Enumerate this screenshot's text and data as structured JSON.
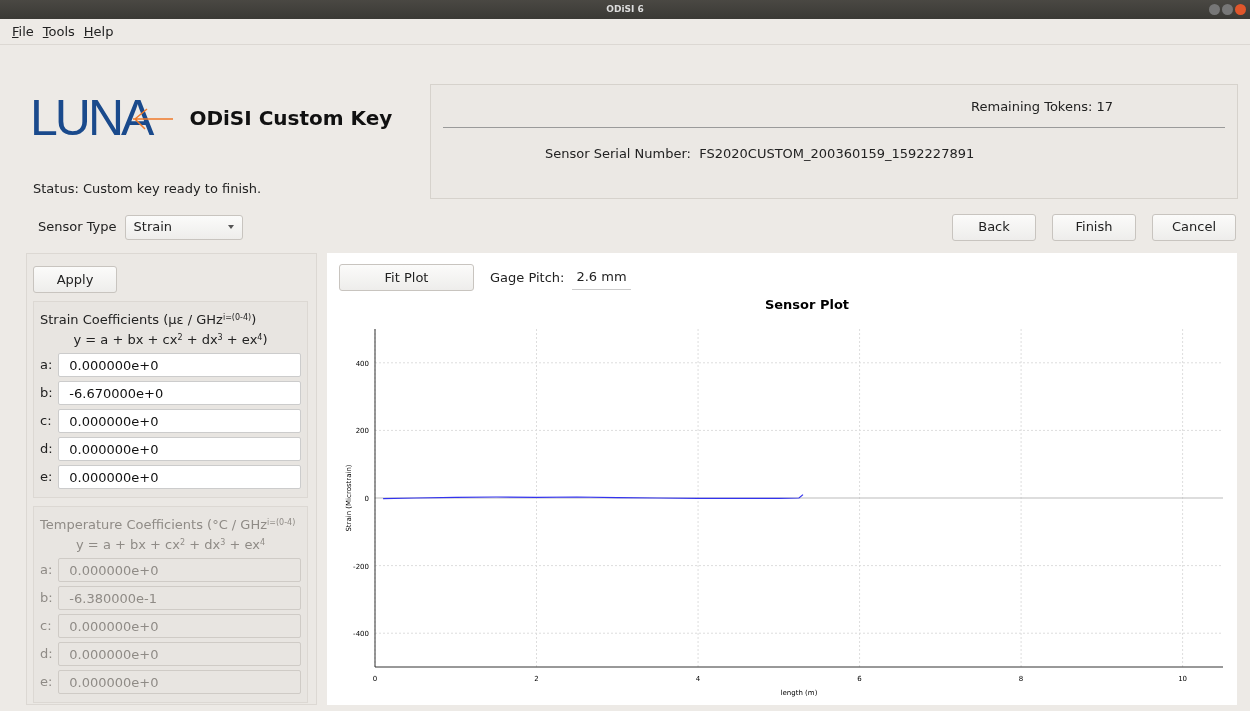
{
  "window": {
    "title": "ODiSI 6"
  },
  "menu": [
    {
      "label": "File"
    },
    {
      "label": "Tools"
    },
    {
      "label": "Help"
    }
  ],
  "header": {
    "logo_text": "LUNA",
    "title": "ODiSI Custom Key",
    "status": "Status: Custom key ready to finish."
  },
  "info": {
    "tokens_label": "Remaining Tokens:",
    "tokens": "17",
    "serial_label": "Sensor Serial Number:",
    "serial": "FS2020CUSTOM_200360159_1592227891"
  },
  "sensor_type": {
    "label": "Sensor Type",
    "value": "Strain"
  },
  "actions": [
    "Back",
    "Finish",
    "Cancel"
  ],
  "apply_button": "Apply",
  "coefficient_groups": [
    {
      "title": "Strain Coefficients (με / GHz$^{i=(0-4)}$)",
      "formula": "y = a + bx + cx$^{2}$ + dx$^{3}$ + ex$^{4}$)",
      "disabled": false,
      "fields": [
        {
          "label": "a:",
          "value": "0.000000e+0"
        },
        {
          "label": "b:",
          "value": "-6.670000e+0"
        },
        {
          "label": "c:",
          "value": "0.000000e+0"
        },
        {
          "label": "d:",
          "value": "0.000000e+0"
        },
        {
          "label": "e:",
          "value": "0.000000e+0"
        }
      ]
    },
    {
      "title": "Temperature Coefficients (°C / GHz$^{i=(0-4)}$",
      "formula": "y = a + bx + cx$^{2}$ + dx$^{3}$ + ex$^{4}$",
      "disabled": true,
      "fields": [
        {
          "label": "a:",
          "value": "0.000000e+0"
        },
        {
          "label": "b:",
          "value": "-6.380000e-1"
        },
        {
          "label": "c:",
          "value": "0.000000e+0"
        },
        {
          "label": "d:",
          "value": "0.000000e+0"
        },
        {
          "label": "e:",
          "value": "0.000000e+0"
        }
      ]
    }
  ],
  "plot_panel": {
    "fit_button": "Fit Plot",
    "gage_label": "Gage Pitch:",
    "gage_value": "2.6 mm",
    "chart_data": {
      "type": "line",
      "title": "Sensor Plot",
      "xlabel": "length (m)",
      "ylabel": "Strain (Microstrain)",
      "x": [
        0.1,
        0.5,
        1.0,
        1.5,
        2.0,
        2.5,
        3.0,
        3.5,
        4.0,
        4.5,
        5.0,
        5.25,
        5.3
      ],
      "grid": true,
      "series": [
        {
          "color": "#3333ee",
          "values": [
            -2,
            0,
            2,
            3,
            2,
            3,
            1,
            0,
            -1,
            -1,
            -1,
            0,
            10
          ]
        }
      ],
      "xlim": [
        0,
        10.5
      ],
      "ylim": [
        -500,
        500
      ],
      "xticks": [
        0,
        2,
        4,
        6,
        8,
        10
      ],
      "yticks": [
        -400,
        -200,
        0,
        200,
        400
      ]
    }
  }
}
